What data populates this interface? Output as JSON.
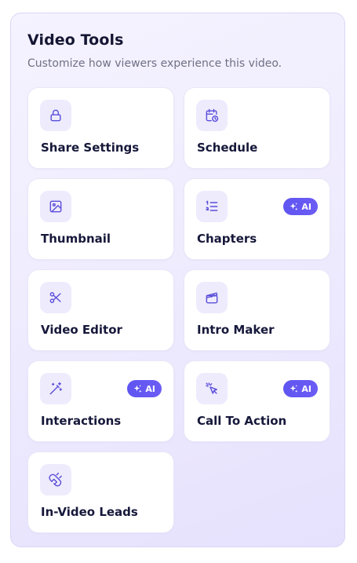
{
  "panel": {
    "title": "Video Tools",
    "subtitle": "Customize how viewers experience this video."
  },
  "tools": [
    {
      "label": "Share Settings",
      "icon": "lock-icon",
      "ai": false
    },
    {
      "label": "Schedule",
      "icon": "calendar-clock-icon",
      "ai": false
    },
    {
      "label": "Thumbnail",
      "icon": "image-icon",
      "ai": false
    },
    {
      "label": "Chapters",
      "icon": "numbered-list-icon",
      "ai": true
    },
    {
      "label": "Video Editor",
      "icon": "scissors-icon",
      "ai": false
    },
    {
      "label": "Intro Maker",
      "icon": "clapperboard-icon",
      "ai": false
    },
    {
      "label": "Interactions",
      "icon": "magic-wand-icon",
      "ai": true
    },
    {
      "label": "Call To Action",
      "icon": "cursor-click-icon",
      "ai": true
    },
    {
      "label": "In-Video Leads",
      "icon": "magnet-icon",
      "ai": false
    }
  ],
  "badge": {
    "label": "AI",
    "icon": "sparkles-icon"
  },
  "colors": {
    "accent": "#5b4fd9",
    "badge": "#6259f1",
    "icon_bg": "#eeebfd",
    "panel_bg": "#efecfe",
    "title": "#141633",
    "subtitle": "#6e7085"
  }
}
